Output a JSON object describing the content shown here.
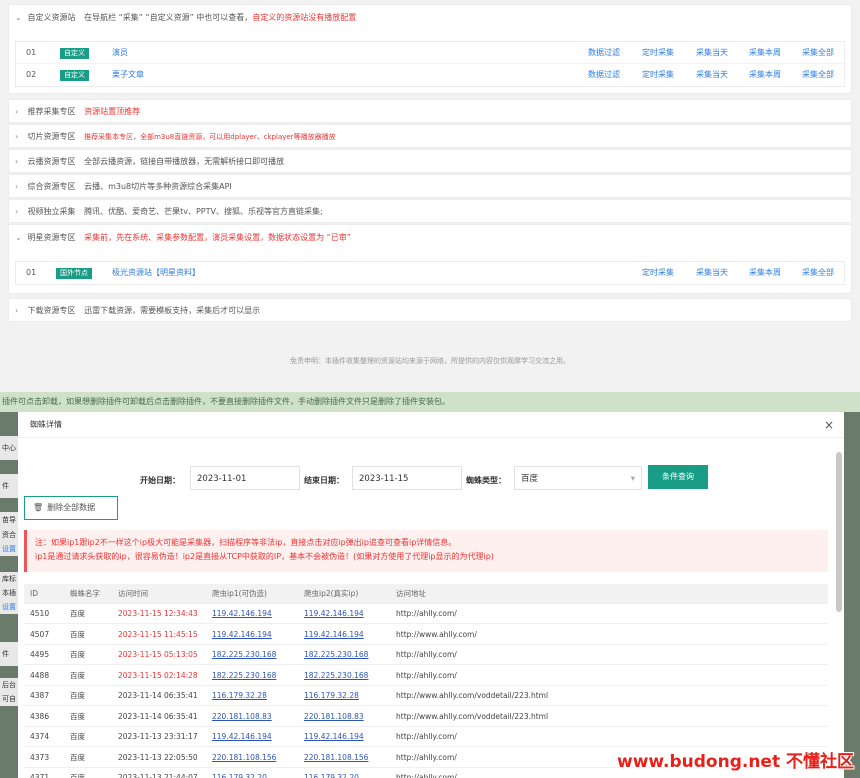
{
  "resources": {
    "custom": {
      "title": "自定义资源站",
      "desc": "在导航栏 “采集” “自定义资源” 中也可以查看，",
      "desc_red": "自定义的资源站没有播放配置",
      "rows": [
        {
          "num": "01",
          "tag": "自定义",
          "name": "演员",
          "actions": [
            "数据过滤",
            "定时采集",
            "采集当天",
            "采集本周",
            "采集全部"
          ]
        },
        {
          "num": "02",
          "tag": "自定义",
          "name": "栗子文章",
          "actions": [
            "数据过滤",
            "定时采集",
            "采集当天",
            "采集本周",
            "采集全部"
          ]
        }
      ]
    },
    "collapsed": [
      {
        "title": "推荐采集专区",
        "desc": "",
        "desc_red": "资源站置顶推荐"
      },
      {
        "title": "切片资源专区",
        "desc": "",
        "desc_red": "推荐采集本专区，全部m3u8直链资源，可以用dplayer、ckplayer等播放器播放"
      },
      {
        "title": "云播资源专区",
        "desc": "全部云播资源，链接自带播放器，无需解析接口即可播放",
        "desc_red": ""
      },
      {
        "title": "综合资源专区",
        "desc": "云播、m3u8切片等多种资源综合采集API",
        "desc_red": ""
      },
      {
        "title": "视频独立采集",
        "desc": "腾讯、优酷、爱奇艺、芒果tv、PPTV、搜狐、乐视等官方直链采集;",
        "desc_red": ""
      }
    ],
    "star": {
      "title": "明星资源专区",
      "desc_red": "采集前，先在系统、采集参数配置，演员采集设置，数据状态设置为 “已审”",
      "rows": [
        {
          "num": "01",
          "tag": "国外节点",
          "name": "极光资源站【明星资料】",
          "actions": [
            "定时采集",
            "采集当天",
            "采集本周",
            "采集全部"
          ]
        }
      ]
    },
    "download": {
      "title": "下载资源专区",
      "desc": "迅雷下载资源，需要模板支持，采集后才可以显示"
    },
    "disclaimer": "免责申明：本插件收集整理的资源站均来源于网络，所提供的内容仅供观摩学习交流之用。"
  },
  "background": {
    "banner": "插件可点击卸载，如果想删除插件可卸载后点击删除插件，不要直接删除插件文件，手动删除插件文件只是删除了插件安装包。",
    "left_frags": [
      "中心",
      "件",
      "苗导",
      "资合",
      "设置",
      "库标",
      "本插",
      "设置",
      "件",
      "后台",
      "可自"
    ]
  },
  "modal": {
    "title": "蜘蛛详情",
    "close": "×",
    "start_label": "开始日期：",
    "start_value": "2023-11-01",
    "end_label": "结束日期：",
    "end_value": "2023-11-15",
    "type_label": "蜘蛛类型：",
    "type_value": "百度",
    "query_btn": "条件查询",
    "delete_btn": "删除全部数据",
    "notice_line1": "注：如果ip1跟ip2不一样这个ip极大可能是采集器，扫描程序等非法ip，直接点击对应ip弹出ip追查可查看ip详情信息。",
    "notice_line2": "ip1是通过请求头获取的ip，很容易伪造！ip2是直接从TCP中获取的IP，基本不会被伪造！(如果对方使用了代理ip显示的为代理ip)",
    "columns": [
      "ID",
      "蜘蛛名字",
      "访问时间",
      "爬虫ip1(可伪造)",
      "爬虫ip2(真实ip)",
      "访问地址"
    ],
    "rows": [
      {
        "id": "4510",
        "name": "百度",
        "time": "2023-11-15 12:34:43",
        "red": true,
        "ip1": "119.42.146.194",
        "ip2": "119.42.146.194",
        "url": "http://ahlly.com/"
      },
      {
        "id": "4507",
        "name": "百度",
        "time": "2023-11-15 11:45:15",
        "red": true,
        "ip1": "119.42.146.194",
        "ip2": "119.42.146.194",
        "url": "http://www.ahlly.com/"
      },
      {
        "id": "4495",
        "name": "百度",
        "time": "2023-11-15 05:13:05",
        "red": true,
        "ip1": "182.225.230.168",
        "ip2": "182.225.230.168",
        "url": "http://ahlly.com/"
      },
      {
        "id": "4488",
        "name": "百度",
        "time": "2023-11-15 02:14:28",
        "red": true,
        "ip1": "182.225.230.168",
        "ip2": "182.225.230.168",
        "url": "http://ahlly.com/"
      },
      {
        "id": "4387",
        "name": "百度",
        "time": "2023-11-14 06:35:41",
        "red": false,
        "ip1": "116.179.32.28",
        "ip2": "116.179.32.28",
        "url": "http://www.ahlly.com/voddetail/223.html"
      },
      {
        "id": "4386",
        "name": "百度",
        "time": "2023-11-14 06:35:41",
        "red": false,
        "ip1": "220.181.108.83",
        "ip2": "220.181.108.83",
        "url": "http://www.ahlly.com/voddetail/223.html"
      },
      {
        "id": "4374",
        "name": "百度",
        "time": "2023-11-13 23:31:17",
        "red": false,
        "ip1": "119.42.146.194",
        "ip2": "119.42.146.194",
        "url": "http://ahlly.com/"
      },
      {
        "id": "4373",
        "name": "百度",
        "time": "2023-11-13 22:05:50",
        "red": false,
        "ip1": "220.181.108.156",
        "ip2": "220.181.108.156",
        "url": "http://ahlly.com/"
      },
      {
        "id": "4371",
        "name": "百度",
        "time": "2023-11-13 21:44:07",
        "red": false,
        "ip1": "116.179.32.20",
        "ip2": "116.179.32.20",
        "url": "http://ahlly.com/"
      }
    ]
  },
  "watermark": "www.budong.net 不懂社区"
}
